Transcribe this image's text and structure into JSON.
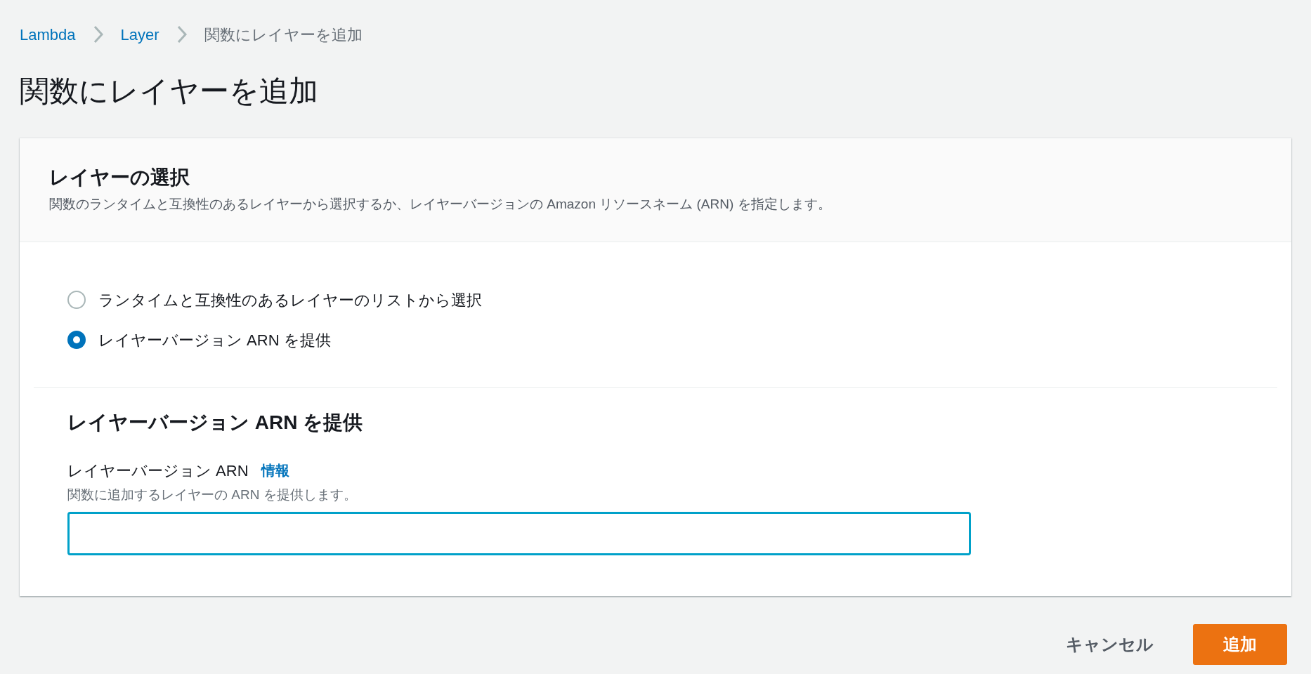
{
  "breadcrumb": [
    {
      "label": "Lambda",
      "kind": "link"
    },
    {
      "label": "Layer",
      "kind": "link"
    },
    {
      "label": "関数にレイヤーを追加",
      "kind": "current"
    }
  ],
  "title": "関数にレイヤーを追加",
  "panel": {
    "title": "レイヤーの選択",
    "description": "関数のランタイムと互換性のあるレイヤーから選択するか、レイヤーバージョンの Amazon リソースネーム (ARN) を指定します。",
    "options": [
      {
        "label": "ランタイムと互換性のあるレイヤーのリストから選択",
        "selected": false
      },
      {
        "label": "レイヤーバージョン ARN を提供",
        "selected": true
      }
    ],
    "section_title": "レイヤーバージョン ARN を提供",
    "field": {
      "label": "レイヤーバージョン ARN",
      "info": "情報",
      "hint": "関数に追加するレイヤーの ARN を提供します。",
      "focused": true
    }
  },
  "buttons": [
    {
      "label": "キャンセル",
      "kind": "link"
    },
    {
      "label": "追加",
      "kind": "primary"
    }
  ]
}
